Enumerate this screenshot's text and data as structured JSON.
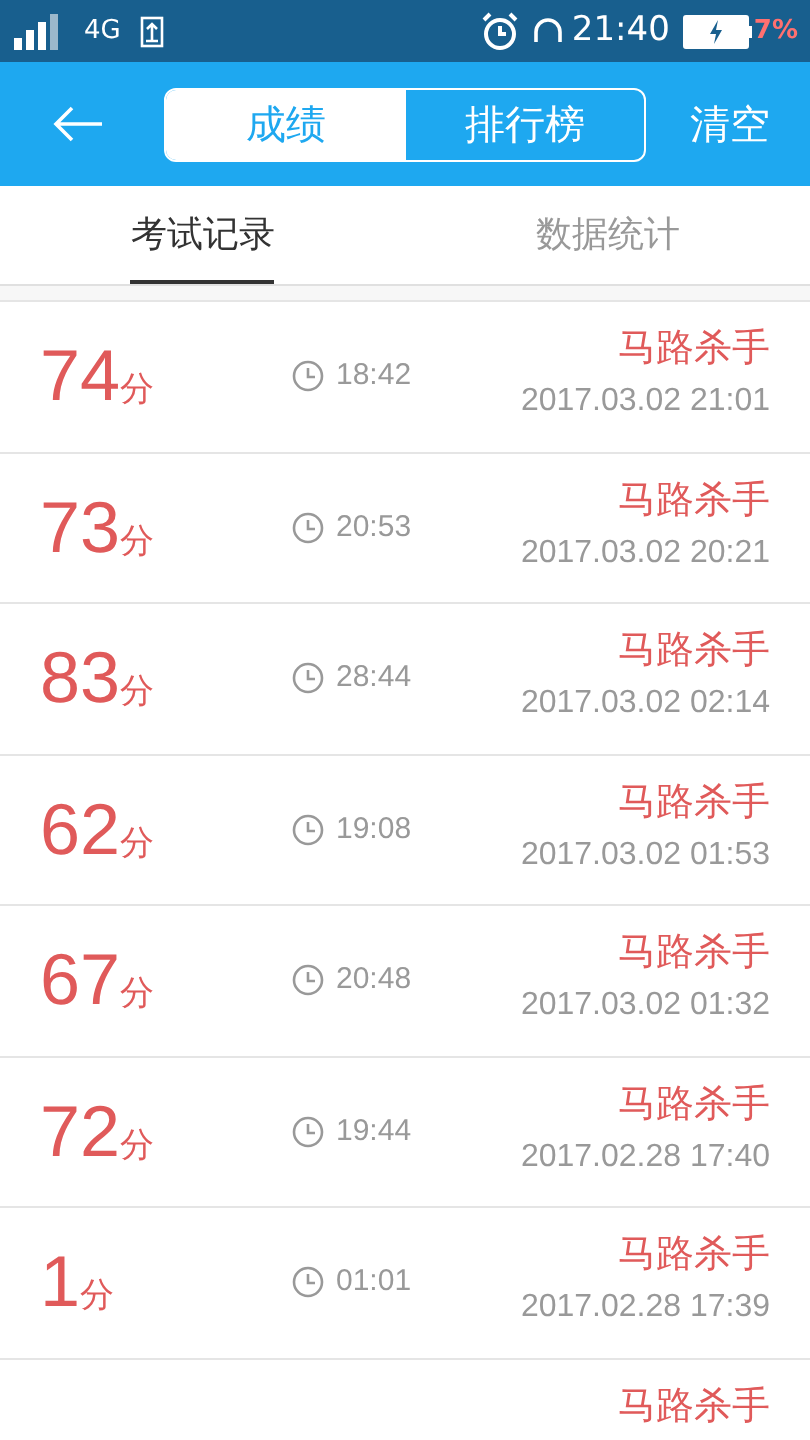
{
  "status_bar": {
    "network": "4G",
    "time": "21:40",
    "battery": "7%"
  },
  "header": {
    "segments": [
      {
        "label": "成绩",
        "selected": true
      },
      {
        "label": "排行榜",
        "selected": false
      }
    ],
    "action": "清空"
  },
  "tabs": [
    {
      "label": "考试记录",
      "selected": true
    },
    {
      "label": "数据统计",
      "selected": false
    }
  ],
  "records": [
    {
      "score": "74",
      "unit": "分",
      "duration": "18:42",
      "title": "马路杀手",
      "date": "2017.03.02 21:01"
    },
    {
      "score": "73",
      "unit": "分",
      "duration": "20:53",
      "title": "马路杀手",
      "date": "2017.03.02 20:21"
    },
    {
      "score": "83",
      "unit": "分",
      "duration": "28:44",
      "title": "马路杀手",
      "date": "2017.03.02 02:14"
    },
    {
      "score": "62",
      "unit": "分",
      "duration": "19:08",
      "title": "马路杀手",
      "date": "2017.03.02 01:53"
    },
    {
      "score": "67",
      "unit": "分",
      "duration": "20:48",
      "title": "马路杀手",
      "date": "2017.03.02 01:32"
    },
    {
      "score": "72",
      "unit": "分",
      "duration": "19:44",
      "title": "马路杀手",
      "date": "2017.02.28 17:40"
    },
    {
      "score": "1",
      "unit": "分",
      "duration": "01:01",
      "title": "马路杀手",
      "date": "2017.02.28 17:39"
    },
    {
      "title": "马路杀手"
    }
  ]
}
